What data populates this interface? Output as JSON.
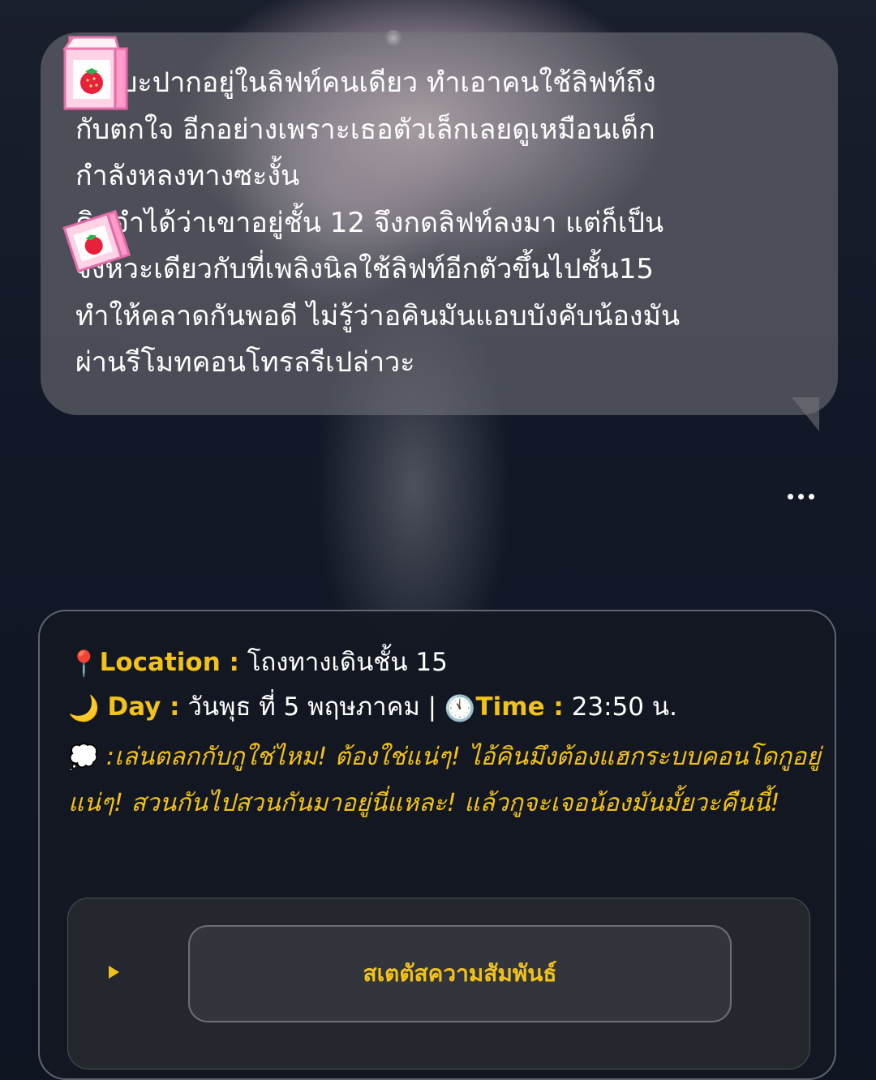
{
  "message": {
    "text": "ยืนเบะปากอยู่ในลิฟท์คนเดียว ทำเอาคนใช้ลิฟท์ถึง\nกับตกใจ อีกอย่างเพราะเธอตัวเล็กเลยดูเหมือนเด็ก\nกำลังหลงทางซะงั้น\nคินจำได้ว่าเขาอยู่ชั้น 12 จึงกดลิฟท์ลงมา แต่ก็เป็น\nจังหวะเดียวกับที่เพลิงนิลใช้ลิฟท์อีกตัวขึ้นไปชั้น15\nทำให้คลาดกันพอดี ไม่รู้ว่าอคินมันแอบบังคับน้องมัน\nผ่านรีโมทคอนโทรลรีเปล่าวะ",
    "sticker_icon": "strawberry-milk-carton-icon"
  },
  "more_menu": {
    "icon": "more-dots-icon"
  },
  "status_card": {
    "location_icon": "📍",
    "location_label": "Location :",
    "location_value": "โถงทางเดินชั้น 15",
    "day_icon": "🌙",
    "day_label": "Day :",
    "day_value": "วันพุธ ที่ 5 พฤษภาคม |",
    "time_icon": "🕚",
    "time_label": "Time :",
    "time_value": "23:50 น.",
    "thought_icon": "💭",
    "thought_text": ":เล่นตลกกับกูใช่ไหม! ต้องใช่แน่ๆ! ไอ้คินมึงต้องแฮกระบบคอนโดกูอยู่แน่ๆ! สวนกันไปสวนกันมาอยู่นี่แหละ! แล้วกูจะเจอน้องมันมั้ยวะคืนนี้!",
    "relationship_button_label": "สเตตัสความสัมพันธ์"
  },
  "colors": {
    "accent": "#f2c21a",
    "bubble": "#78787e",
    "card_bg": "#141822"
  }
}
